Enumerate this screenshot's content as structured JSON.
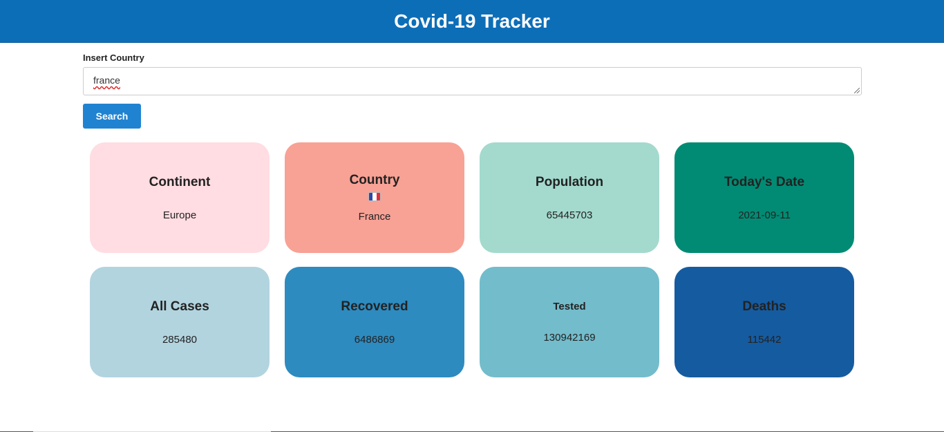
{
  "header": {
    "title": "Covid-19 Tracker"
  },
  "form": {
    "label": "Insert Country",
    "value": "france",
    "button_label": "Search"
  },
  "cards": {
    "continent": {
      "title": "Continent",
      "value": "Europe",
      "color": "#ffdde2"
    },
    "country": {
      "title": "Country",
      "value": "France",
      "flag_icon": "france-flag-icon",
      "color": "#f8a195"
    },
    "population": {
      "title": "Population",
      "value": "65445703",
      "color": "#a3dacd"
    },
    "date": {
      "title": "Today's Date",
      "value": "2021-09-11",
      "color": "#018b74"
    },
    "cases": {
      "title": "All Cases",
      "value": "285480",
      "color": "#b2d4df"
    },
    "recovered": {
      "title": "Recovered",
      "value": "6486869",
      "color": "#2d8bc0"
    },
    "tested": {
      "title": "Tested",
      "value": "130942169",
      "color": "#73bccb"
    },
    "deaths": {
      "title": "Deaths",
      "value": "115442",
      "color": "#155ba0"
    }
  },
  "colors": {
    "header": "#0d6eb8",
    "button": "#2083d1"
  }
}
